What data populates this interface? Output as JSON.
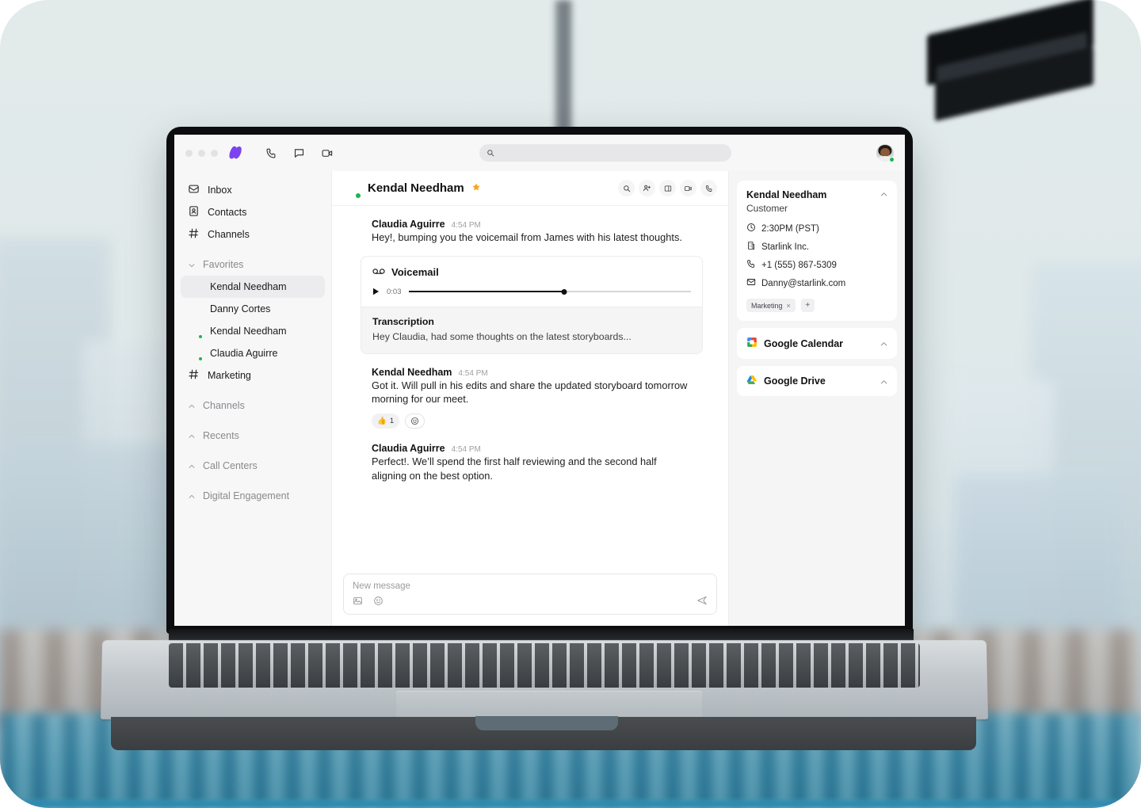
{
  "app": {
    "brand_logo_name": "dialpad-logo",
    "brand_color": "#7b44f0",
    "accent_star_color": "#f5a623",
    "presence_color": "#16b84e"
  },
  "toolbar": {
    "window_controls": [
      "close",
      "minimize",
      "zoom"
    ],
    "icons": [
      {
        "name": "phone-icon",
        "label": "Calls"
      },
      {
        "name": "message-icon",
        "label": "Messages"
      },
      {
        "name": "video-icon",
        "label": "Meetings"
      }
    ],
    "search": {
      "placeholder": "",
      "value": "",
      "icon": "search-icon"
    },
    "account_avatar": "current-user-avatar"
  },
  "sidebar": {
    "primary": [
      {
        "label": "Inbox",
        "icon": "inbox-icon"
      },
      {
        "label": "Contacts",
        "icon": "contacts-icon"
      },
      {
        "label": "Channels",
        "icon": "hash-icon"
      }
    ],
    "groups": [
      {
        "label": "Favorites",
        "expanded": true,
        "caret": "chevron-down-icon",
        "items": [
          {
            "label": "Kendal Needham",
            "type": "person",
            "avatar": "m",
            "presence": false,
            "selected": true
          },
          {
            "label": "Danny Cortes",
            "type": "person",
            "avatar": "d",
            "presence": false,
            "selected": false
          },
          {
            "label": "Kendal Needham",
            "type": "person",
            "avatar": "m",
            "presence": true,
            "selected": false
          },
          {
            "label": "Claudia Aguirre",
            "type": "person",
            "avatar": "w",
            "presence": true,
            "selected": false
          },
          {
            "label": "Marketing",
            "type": "channel",
            "icon": "hash-icon",
            "selected": false
          }
        ]
      },
      {
        "label": "Channels",
        "expanded": false,
        "caret": "chevron-up-icon",
        "items": []
      },
      {
        "label": "Recents",
        "expanded": false,
        "caret": "chevron-up-icon",
        "items": []
      },
      {
        "label": "Call Centers",
        "expanded": false,
        "caret": "chevron-up-icon",
        "items": []
      },
      {
        "label": "Digital Engagement",
        "expanded": false,
        "caret": "chevron-up-icon",
        "items": []
      }
    ]
  },
  "conversation": {
    "title": "Kendal Needham",
    "starred": true,
    "star_icon": "star-icon",
    "avatar": "m",
    "presence": true,
    "actions": [
      {
        "name": "search-in-conversation-icon"
      },
      {
        "name": "add-person-icon"
      },
      {
        "name": "open-panel-icon"
      },
      {
        "name": "video-call-icon"
      },
      {
        "name": "phone-call-icon"
      }
    ],
    "messages": [
      {
        "author": "Claudia Aguirre",
        "avatar": "w",
        "time": "4:54 PM",
        "text": "Hey!, bumping you the voicemail from James with his latest thoughts.",
        "attachment": {
          "type": "voicemail",
          "title": "Voicemail",
          "icon": "voicemail-icon",
          "play_icon": "play-icon",
          "elapsed": "0:03",
          "progress_percent": 55,
          "transcription_label": "Transcription",
          "transcription_text": "Hey Claudia, had some thoughts on the latest storyboards..."
        },
        "reactions": []
      },
      {
        "author": "Kendal Needham",
        "avatar": "m",
        "time": "4:54 PM",
        "text": "Got it. Will pull in his edits and share the updated storyboard tomorrow morning for our meet.",
        "reactions": [
          {
            "emoji": "👍",
            "count": "1"
          },
          {
            "emoji": "add",
            "count": ""
          }
        ]
      },
      {
        "author": "Claudia Aguirre",
        "avatar": "w",
        "time": "4:54 PM",
        "text": "Perfect!. We’ll spend the first half reviewing and the second half aligning on the best option.",
        "reactions": []
      }
    ],
    "composer": {
      "placeholder": "New message",
      "value": "",
      "actions": [
        {
          "name": "image-attach-icon"
        },
        {
          "name": "emoji-icon"
        }
      ],
      "send_icon": "send-icon"
    }
  },
  "right_panel": {
    "contact": {
      "name": "Kendal Needham",
      "role": "Customer",
      "caret": "chevron-up-icon",
      "details": [
        {
          "icon": "clock-icon",
          "value": "2:30PM (PST)"
        },
        {
          "icon": "building-icon",
          "value": "Starlink Inc."
        },
        {
          "icon": "phone-icon",
          "value": "+1 (555) 867-5309"
        },
        {
          "icon": "mail-icon",
          "value": "Danny@starlink.com"
        }
      ],
      "tags": [
        {
          "label": "Marketing",
          "removable": true,
          "remove_glyph": "×"
        }
      ],
      "add_tag_glyph": "+"
    },
    "integrations": [
      {
        "label": "Google Calendar",
        "icon": "google-calendar-icon",
        "caret": "chevron-up-icon"
      },
      {
        "label": "Google Drive",
        "icon": "google-drive-icon",
        "caret": "chevron-up-icon"
      }
    ]
  }
}
